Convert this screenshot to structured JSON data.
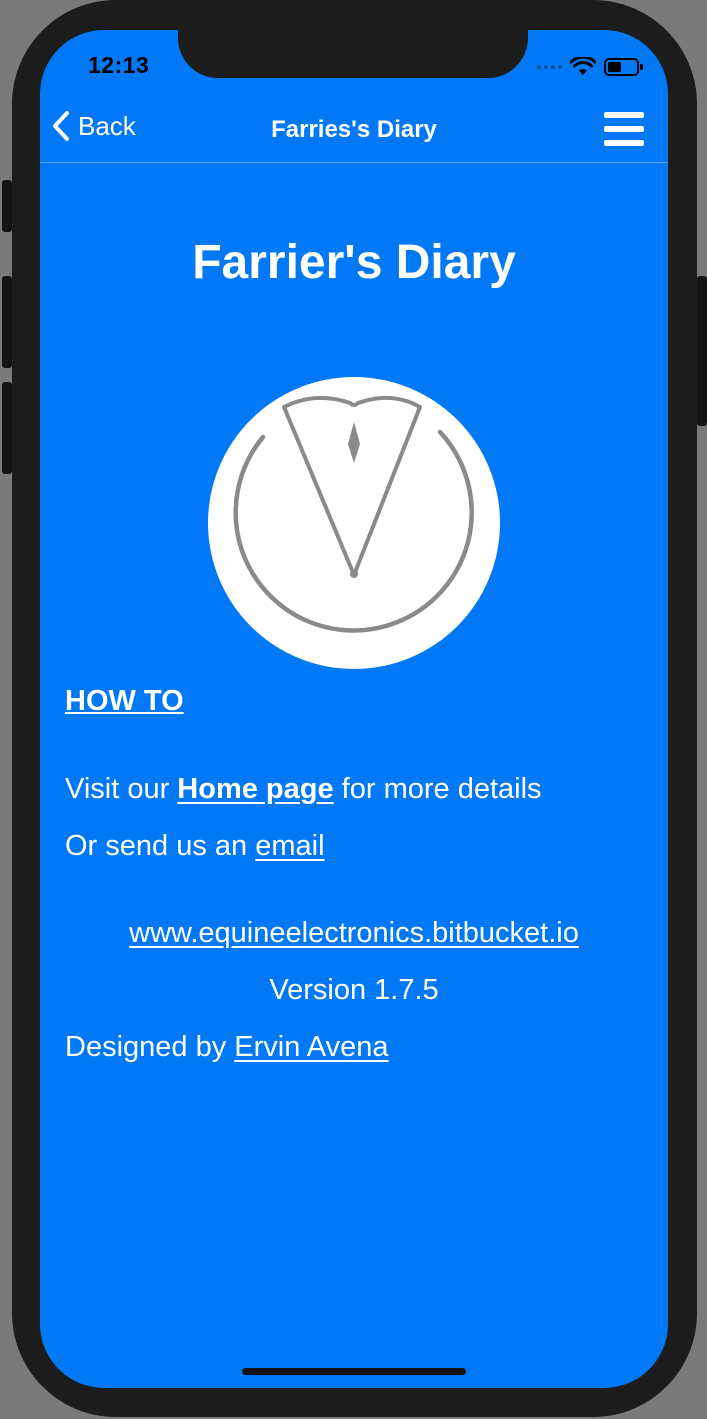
{
  "status_bar": {
    "time": "12:13"
  },
  "nav": {
    "back_label": "Back",
    "title": "Farries's Diary",
    "back_icon": "chevron-left-icon",
    "menu_icon": "hamburger-menu-icon"
  },
  "page": {
    "title": "Farrier's Diary",
    "logo": "farrier-logo"
  },
  "content": {
    "howto": "HOW TO",
    "visit_prefix": "Visit our ",
    "home_link": "Home page",
    "visit_suffix": " for more details",
    "send_prefix": "Or send us an ",
    "email_link": "email",
    "website": "www.equineelectronics.bitbucket.io",
    "version": "Version 1.7.5",
    "designed_prefix": "Designed by ",
    "designer": "Ervin Avena"
  },
  "colors": {
    "background": "#0179f6",
    "text": "#ffffff",
    "device": "#1c1c1c"
  }
}
